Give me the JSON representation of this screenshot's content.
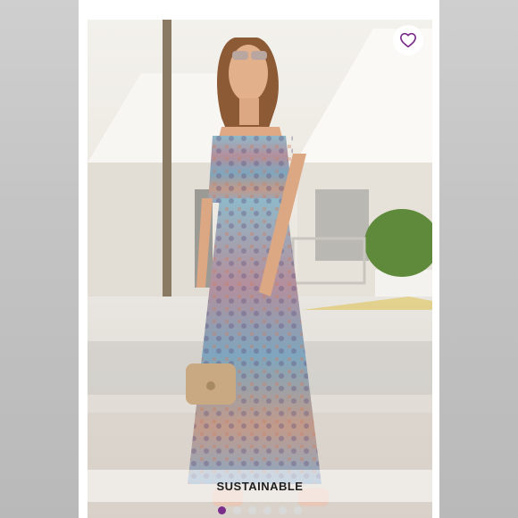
{
  "listing": {
    "badge_label": "SUSTAINABLE",
    "like_icon": "heart-outline-icon",
    "accent_color": "#7a2d8a",
    "carousel": {
      "active_index": 0,
      "visible_dots": 6
    }
  }
}
